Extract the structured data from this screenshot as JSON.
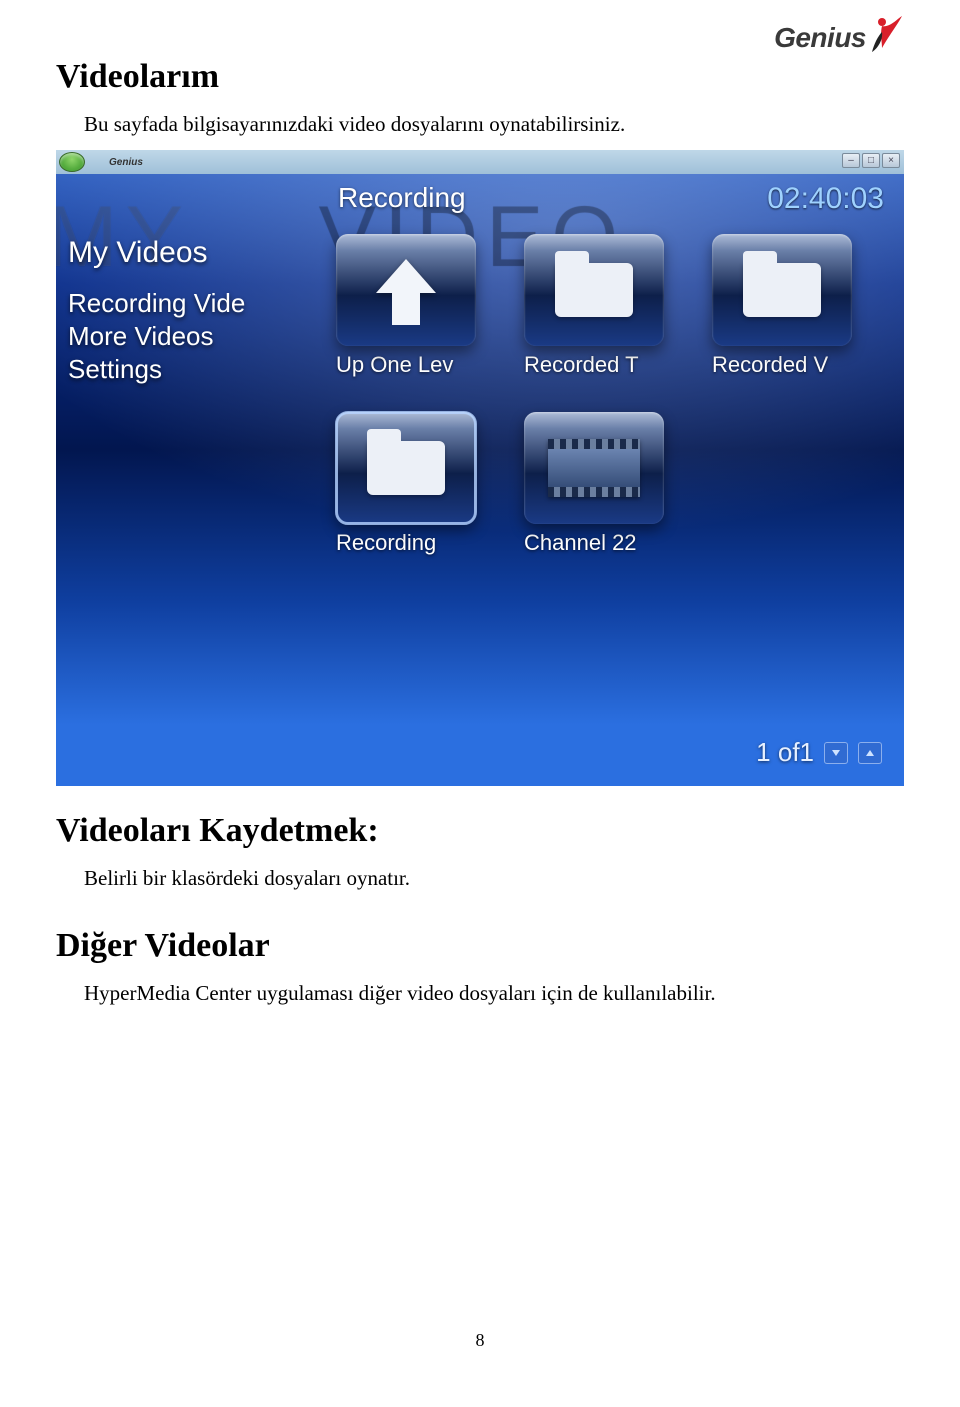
{
  "logo_text": "Genius",
  "doc": {
    "heading1": "Videolarım",
    "body1": "Bu sayfada bilgisayarınızdaki video dosyalarını oynatabilirsiniz.",
    "heading2": "Videoları Kaydetmek:",
    "body2": "Belirli bir klasördeki dosyaları oynatır.",
    "heading3": "Diğer Videolar",
    "body3": "HyperMedia Center uygulaması diğer video dosyaları için de kullanılabilir.",
    "page_number": "8"
  },
  "app": {
    "brand": "Genius",
    "watermark_left": "MY",
    "watermark_right": "VIDEO",
    "section_label": "Recording",
    "clock": "02:40:03",
    "sidebar": {
      "title": "My Videos",
      "items": [
        "Recording Vide",
        "More Videos",
        "Settings"
      ]
    },
    "tiles": [
      {
        "label": "Up One Lev",
        "icon": "up"
      },
      {
        "label": "Recorded T",
        "icon": "folder"
      },
      {
        "label": "Recorded V",
        "icon": "folder"
      },
      {
        "label": "Recording",
        "icon": "folder",
        "selected": true
      },
      {
        "label": "Channel 22",
        "icon": "film"
      }
    ],
    "pager": {
      "text": "1 of1"
    },
    "window_buttons": [
      "–",
      "□",
      "×"
    ]
  }
}
